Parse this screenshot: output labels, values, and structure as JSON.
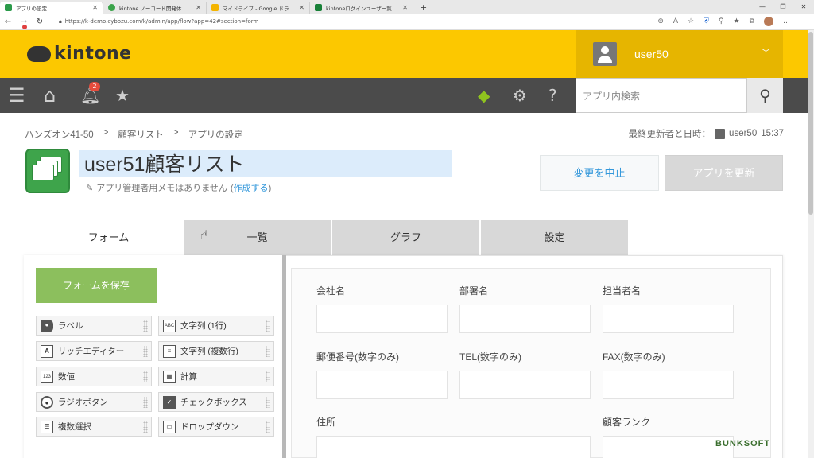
{
  "browser": {
    "tabs": [
      {
        "title": "アプリの設定",
        "color": "#2b9a4a",
        "active": true
      },
      {
        "title": "kintone ノーコード開発体験ハンズオン",
        "color": "#3aa34a",
        "active": false
      },
      {
        "title": "マイドライブ - Google ドライブ",
        "color": "#f4b400",
        "active": false
      },
      {
        "title": "kintoneログインユーザー覧 - Google",
        "color": "#188038",
        "active": false
      }
    ],
    "url": "https://k-demo.cybozu.com/k/admin/app/flow?app=42#section=form"
  },
  "header": {
    "logo_text": "kintone",
    "user_name": "user50",
    "notification_count": "2",
    "search_placeholder": "アプリ内検索"
  },
  "breadcrumb": [
    "ハンズオン41-50",
    ">",
    "顧客リスト",
    ">",
    "アプリの設定"
  ],
  "last_updated": {
    "label": "最終更新者と日時：",
    "user": "user50",
    "time": "15:37"
  },
  "app": {
    "name": "user51顧客リスト",
    "memo_text": "アプリ管理者用メモはありません",
    "memo_link": "作成する",
    "cancel_label": "変更を中止",
    "update_label": "アプリを更新"
  },
  "tabs": [
    "フォーム",
    "一覧",
    "グラフ",
    "設定"
  ],
  "palette": {
    "save_label": "フォームを保存",
    "items": [
      {
        "label": "ラベル",
        "icon": "tag-icon"
      },
      {
        "label": "文字列 (1行)",
        "icon": "abc-icon"
      },
      {
        "label": "リッチエディター",
        "icon": "rich-text-icon"
      },
      {
        "label": "文字列 (複数行)",
        "icon": "multiline-icon"
      },
      {
        "label": "数値",
        "icon": "number-icon"
      },
      {
        "label": "計算",
        "icon": "calculator-icon"
      },
      {
        "label": "ラジオボタン",
        "icon": "radio-icon"
      },
      {
        "label": "チェックボックス",
        "icon": "checkbox-icon"
      },
      {
        "label": "複数選択",
        "icon": "multi-select-icon"
      },
      {
        "label": "ドロップダウン",
        "icon": "dropdown-icon"
      }
    ]
  },
  "form_fields": {
    "company": "会社名",
    "department": "部署名",
    "contact": "担当者名",
    "zip": "郵便番号(数字のみ)",
    "tel": "TEL(数字のみ)",
    "fax": "FAX(数字のみ)",
    "address": "住所",
    "rank": "顧客ランク"
  },
  "watermark": "BUNKSOFT",
  "colors": {
    "brand_yellow": "#fcc800",
    "nav_dark": "#4b4b4b",
    "save_green": "#8cbf5d",
    "link_blue": "#3498db"
  }
}
